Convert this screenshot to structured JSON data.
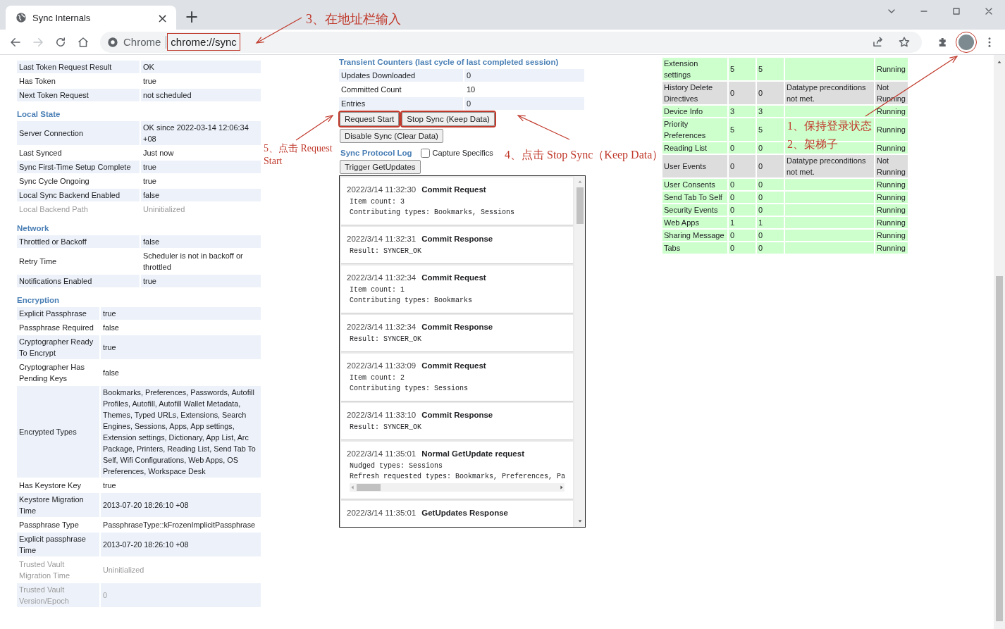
{
  "browser": {
    "tab": {
      "title": "Sync Internals",
      "close": "×"
    },
    "new_tab": "+",
    "omnibox": {
      "site_label": "Chrome",
      "url": "chrome://sync",
      "highlighted": true
    },
    "profile": {
      "highlighted": true
    }
  },
  "left_sections": [
    {
      "rows": [
        {
          "label": "Last Token Request Result",
          "value": "OK",
          "greyed": false
        },
        {
          "label": "Has Token",
          "value": "true",
          "greyed": false
        },
        {
          "label": "Next Token Request",
          "value": "not scheduled",
          "greyed": false
        }
      ]
    },
    {
      "heading": "Local State",
      "rows": [
        {
          "label": "Server Connection",
          "value": "OK since 2022-03-14 12:06:34 +08",
          "greyed": false
        },
        {
          "label": "Last Synced",
          "value": "Just now",
          "greyed": false
        },
        {
          "label": "Sync First-Time Setup Complete",
          "value": "true",
          "greyed": false
        },
        {
          "label": "Sync Cycle Ongoing",
          "value": "true",
          "greyed": false
        },
        {
          "label": "Local Sync Backend Enabled",
          "value": "false",
          "greyed": false
        },
        {
          "label": "Local Backend Path",
          "value": "Uninitialized",
          "greyed": true
        }
      ]
    },
    {
      "heading": "Network",
      "rows": [
        {
          "label": "Throttled or Backoff",
          "value": "false",
          "greyed": false
        },
        {
          "label": "Retry Time",
          "value": "Scheduler is not in backoff or throttled",
          "greyed": false
        },
        {
          "label": "Notifications Enabled",
          "value": "true",
          "greyed": false
        }
      ]
    },
    {
      "heading": "Encryption",
      "rows": [
        {
          "label": "Explicit Passphrase",
          "value": "true",
          "greyed": false
        },
        {
          "label": "Passphrase Required",
          "value": "false",
          "greyed": false
        },
        {
          "label": "Cryptographer Ready To Encrypt",
          "value": "true",
          "greyed": false
        },
        {
          "label": "Cryptographer Has Pending Keys",
          "value": "false",
          "greyed": false
        },
        {
          "label": "Encrypted Types",
          "value": "Bookmarks, Preferences, Passwords, Autofill Profiles, Autofill, Autofill Wallet Metadata, Themes, Typed URLs, Extensions, Search Engines, Sessions, Apps, App settings, Extension settings, Dictionary, App List, Arc Package, Printers, Reading List, Send Tab To Self, Wifi Configurations, Web Apps, OS Preferences, Workspace Desk",
          "greyed": false
        },
        {
          "label": "Has Keystore Key",
          "value": "true",
          "greyed": false
        },
        {
          "label": "Keystore Migration Time",
          "value": "2013-07-20 18:26:10 +08",
          "greyed": false
        },
        {
          "label": "Passphrase Type",
          "value": "PassphraseType::kFrozenImplicitPassphrase",
          "greyed": false
        },
        {
          "label": "Explicit passphrase Time",
          "value": "2013-07-20 18:26:10 +08",
          "greyed": false
        },
        {
          "label": "Trusted Vault Migration Time",
          "value": "Uninitialized",
          "greyed": true
        },
        {
          "label": "Trusted Vault Version/Epoch",
          "value": "0",
          "greyed": true
        }
      ]
    }
  ],
  "middle": {
    "counters_heading": "Transient Counters (last cycle of last completed session)",
    "counters": [
      {
        "label": "Updates Downloaded",
        "value": "0"
      },
      {
        "label": "Committed Count",
        "value": "10"
      },
      {
        "label": "Entries",
        "value": "0"
      }
    ],
    "buttons": [
      {
        "label": "Request Start",
        "highlighted": true
      },
      {
        "label": "Stop Sync (Keep Data)",
        "highlighted": true
      },
      {
        "label": "Disable Sync (Clear Data)",
        "highlighted": false
      }
    ],
    "log_heading": "Sync Protocol Log",
    "capture": {
      "label": "Capture Specifics",
      "checked": false
    },
    "trigger_button": "Trigger GetUpdates",
    "log_entries": [
      {
        "time": "2022/3/14 11:32:30",
        "title": "Commit Request",
        "details": [
          "Item count: 3",
          "Contributing types: Bookmarks, Sessions"
        ],
        "h_scrollbar": false
      },
      {
        "time": "2022/3/14 11:32:31",
        "title": "Commit Response",
        "details": [
          "Result: SYNCER_OK"
        ],
        "h_scrollbar": false
      },
      {
        "time": "2022/3/14 11:32:34",
        "title": "Commit Request",
        "details": [
          "Item count: 1",
          "Contributing types: Bookmarks"
        ],
        "h_scrollbar": false
      },
      {
        "time": "2022/3/14 11:32:34",
        "title": "Commit Response",
        "details": [
          "Result: SYNCER_OK"
        ],
        "h_scrollbar": false
      },
      {
        "time": "2022/3/14 11:33:09",
        "title": "Commit Request",
        "details": [
          "Item count: 2",
          "Contributing types: Sessions"
        ],
        "h_scrollbar": false
      },
      {
        "time": "2022/3/14 11:33:10",
        "title": "Commit Response",
        "details": [
          "Result: SYNCER_OK"
        ],
        "h_scrollbar": false
      },
      {
        "time": "2022/3/14 11:35:01",
        "title": "Normal GetUpdate request",
        "details": [
          "Nudged types: Sessions",
          "Refresh requested types: Bookmarks, Preferences, Pa"
        ],
        "h_scrollbar": true
      },
      {
        "time": "2022/3/14 11:35:01",
        "title": "GetUpdates Response",
        "h_scrollbar": false
      }
    ]
  },
  "datatypes": [
    {
      "name": "Extension settings",
      "count_1": "5",
      "count_2": "5",
      "state": "Running",
      "kind": "running"
    },
    {
      "name": "History Delete Directives",
      "count_1": "0",
      "count_2": "0",
      "message": "Datatype preconditions not met.",
      "state": "Not Running",
      "kind": "stopped"
    },
    {
      "name": "Device Info",
      "count_1": "3",
      "count_2": "3",
      "state": "Running",
      "kind": "running"
    },
    {
      "name": "Priority Preferences",
      "count_1": "5",
      "count_2": "5",
      "state": "Running",
      "kind": "running"
    },
    {
      "name": "Reading List",
      "count_1": "0",
      "count_2": "0",
      "state": "Running",
      "kind": "running"
    },
    {
      "name": "User Events",
      "count_1": "0",
      "count_2": "0",
      "message": "Datatype preconditions not met.",
      "state": "Not Running",
      "kind": "stopped"
    },
    {
      "name": "User Consents",
      "count_1": "0",
      "count_2": "0",
      "state": "Running",
      "kind": "running"
    },
    {
      "name": "Send Tab To Self",
      "count_1": "0",
      "count_2": "0",
      "state": "Running",
      "kind": "running"
    },
    {
      "name": "Security Events",
      "count_1": "0",
      "count_2": "0",
      "state": "Running",
      "kind": "running"
    },
    {
      "name": "Web Apps",
      "count_1": "1",
      "count_2": "1",
      "state": "Running",
      "kind": "running"
    },
    {
      "name": "Sharing Message",
      "count_1": "0",
      "count_2": "0",
      "state": "Running",
      "kind": "running"
    },
    {
      "name": "Tabs",
      "count_1": "0",
      "count_2": "0",
      "state": "Running",
      "kind": "running"
    }
  ],
  "annotations": [
    {
      "text": "3、在地址栏输入"
    },
    {
      "text": "5、点击 Request Start"
    },
    {
      "text": "4、点击 Stop Sync（Keep Data）"
    },
    {
      "text": "1、保持登录状态"
    },
    {
      "text": "2、架梯子"
    }
  ]
}
